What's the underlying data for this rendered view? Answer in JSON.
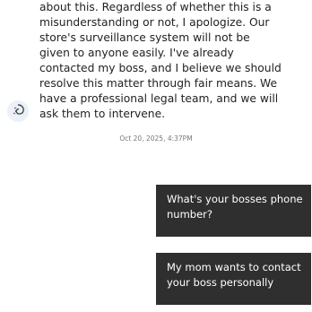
{
  "conversation": {
    "incoming_message": {
      "text": "about this. Regardless of whether this is a misunderstanding or not, I apologize. Our store's surveillance system will not be given to anyone easily. I've already contacted my boss, and I believe we should resolve this matter through fair means. We have a professional legal team, and we will ask them to intervene.",
      "avatar_icon": "spiral-avatar-icon"
    },
    "timestamp": "Oct 20, 2025, 4:37PM",
    "outgoing_messages": [
      {
        "text": "What's your bosses phone number?"
      },
      {
        "text": "My mom wants to contact your boss personally"
      }
    ]
  }
}
